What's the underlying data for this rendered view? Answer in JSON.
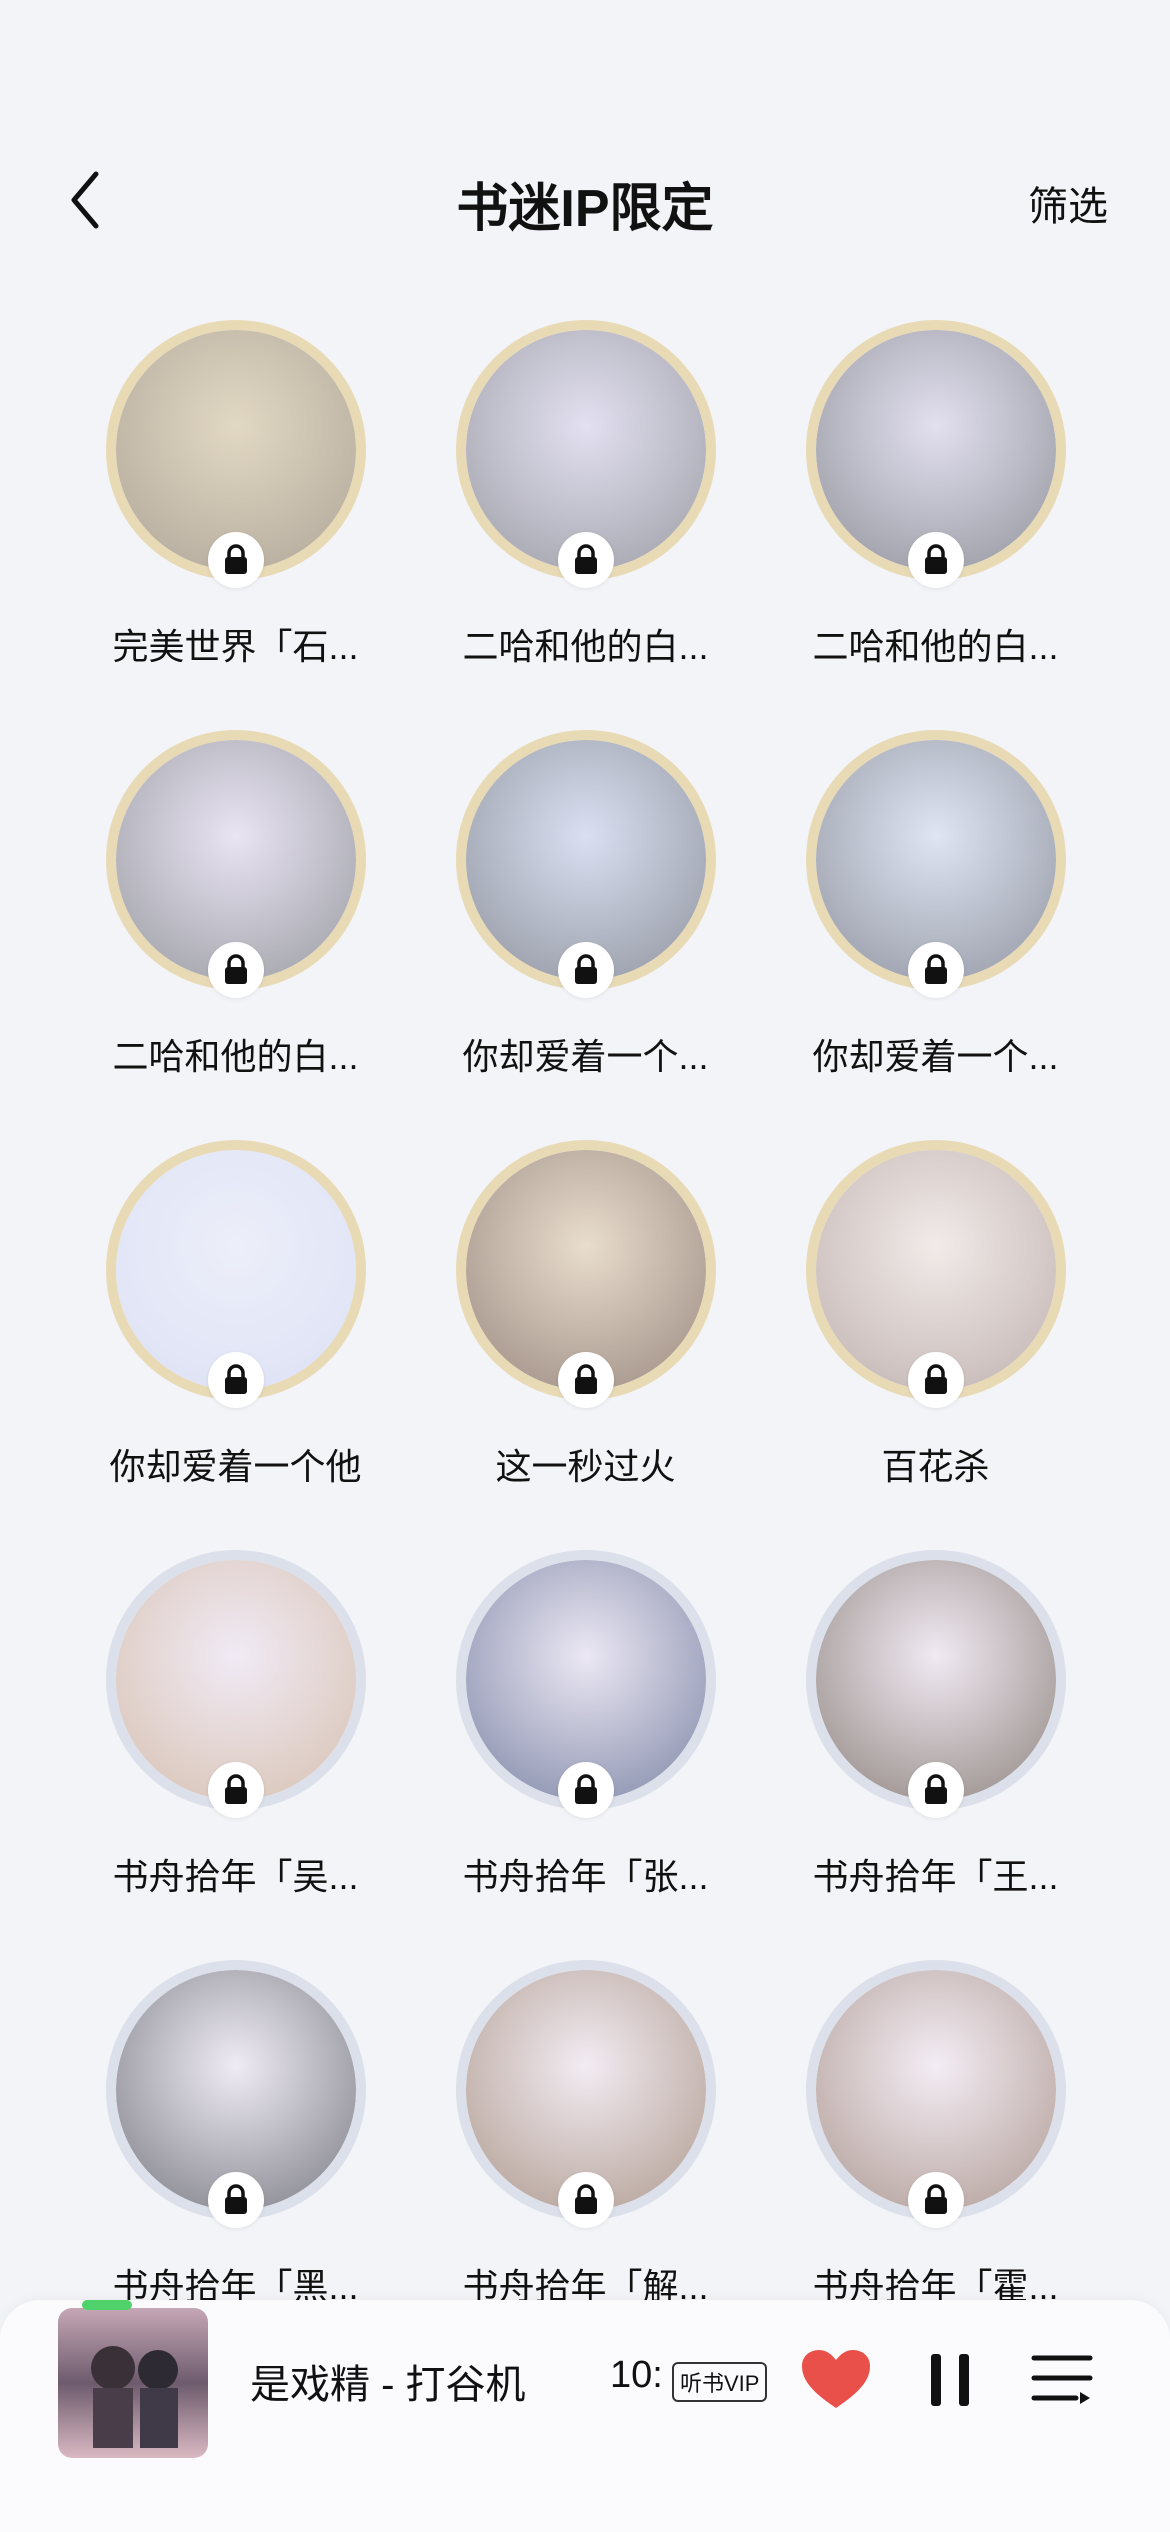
{
  "header": {
    "title": "书迷IP限定",
    "filter_label": "筛选"
  },
  "badges": [
    {
      "label": "完美世界「石...",
      "palette": [
        "#8a7a62",
        "#d7c7a3"
      ],
      "ring": "gold"
    },
    {
      "label": "二哈和他的白...",
      "palette": [
        "#6d6e79",
        "#d9d4ec"
      ],
      "ring": "gold"
    },
    {
      "label": "二哈和他的白...",
      "palette": [
        "#5d5f6a",
        "#d8d3ea"
      ],
      "ring": "gold"
    },
    {
      "label": "二哈和他的白...",
      "palette": [
        "#6a6b74",
        "#e2dbef"
      ],
      "ring": "gold"
    },
    {
      "label": "你却爱着一个...",
      "palette": [
        "#5a5f6d",
        "#c9d3ee"
      ],
      "ring": "gold"
    },
    {
      "label": "你却爱着一个...",
      "palette": [
        "#5c6272",
        "#d3dbf0"
      ],
      "ring": "gold"
    },
    {
      "label": "你却爱着一个他",
      "palette": [
        "#cfd6f3",
        "#e8ecfa"
      ],
      "ring": "gold"
    },
    {
      "label": "这一秒过火",
      "palette": [
        "#6b4f3f",
        "#e2cfb2"
      ],
      "ring": "gold"
    },
    {
      "label": "百花杀",
      "palette": [
        "#a48e88",
        "#f0e5de"
      ],
      "ring": "gold"
    },
    {
      "label": "书舟拾年「吴...",
      "palette": [
        "#c7a58a",
        "#efe4f3"
      ],
      "ring": "silver"
    },
    {
      "label": "书舟拾年「张...",
      "palette": [
        "#3f4b7a",
        "#e7e0f1"
      ],
      "ring": "silver"
    },
    {
      "label": "书舟拾年「王...",
      "palette": [
        "#5a4a40",
        "#efe3ef"
      ],
      "ring": "silver"
    },
    {
      "label": "书舟拾年「黑...",
      "palette": [
        "#3a3a44",
        "#ece6f2"
      ],
      "ring": "silver"
    },
    {
      "label": "书舟拾年「解...",
      "palette": [
        "#8a6a55",
        "#f1e6ef"
      ],
      "ring": "silver"
    },
    {
      "label": "书舟拾年「霍...",
      "palette": [
        "#8b6b5e",
        "#f3e8f2"
      ],
      "ring": "silver"
    }
  ],
  "player": {
    "track_title": "是戏精 - 打谷机",
    "time": "10:",
    "vip_badge": "听书VIP"
  },
  "colors": {
    "background": "#f3f4f8",
    "heart": "#e9504a",
    "lock_bg": "#ffffff"
  }
}
